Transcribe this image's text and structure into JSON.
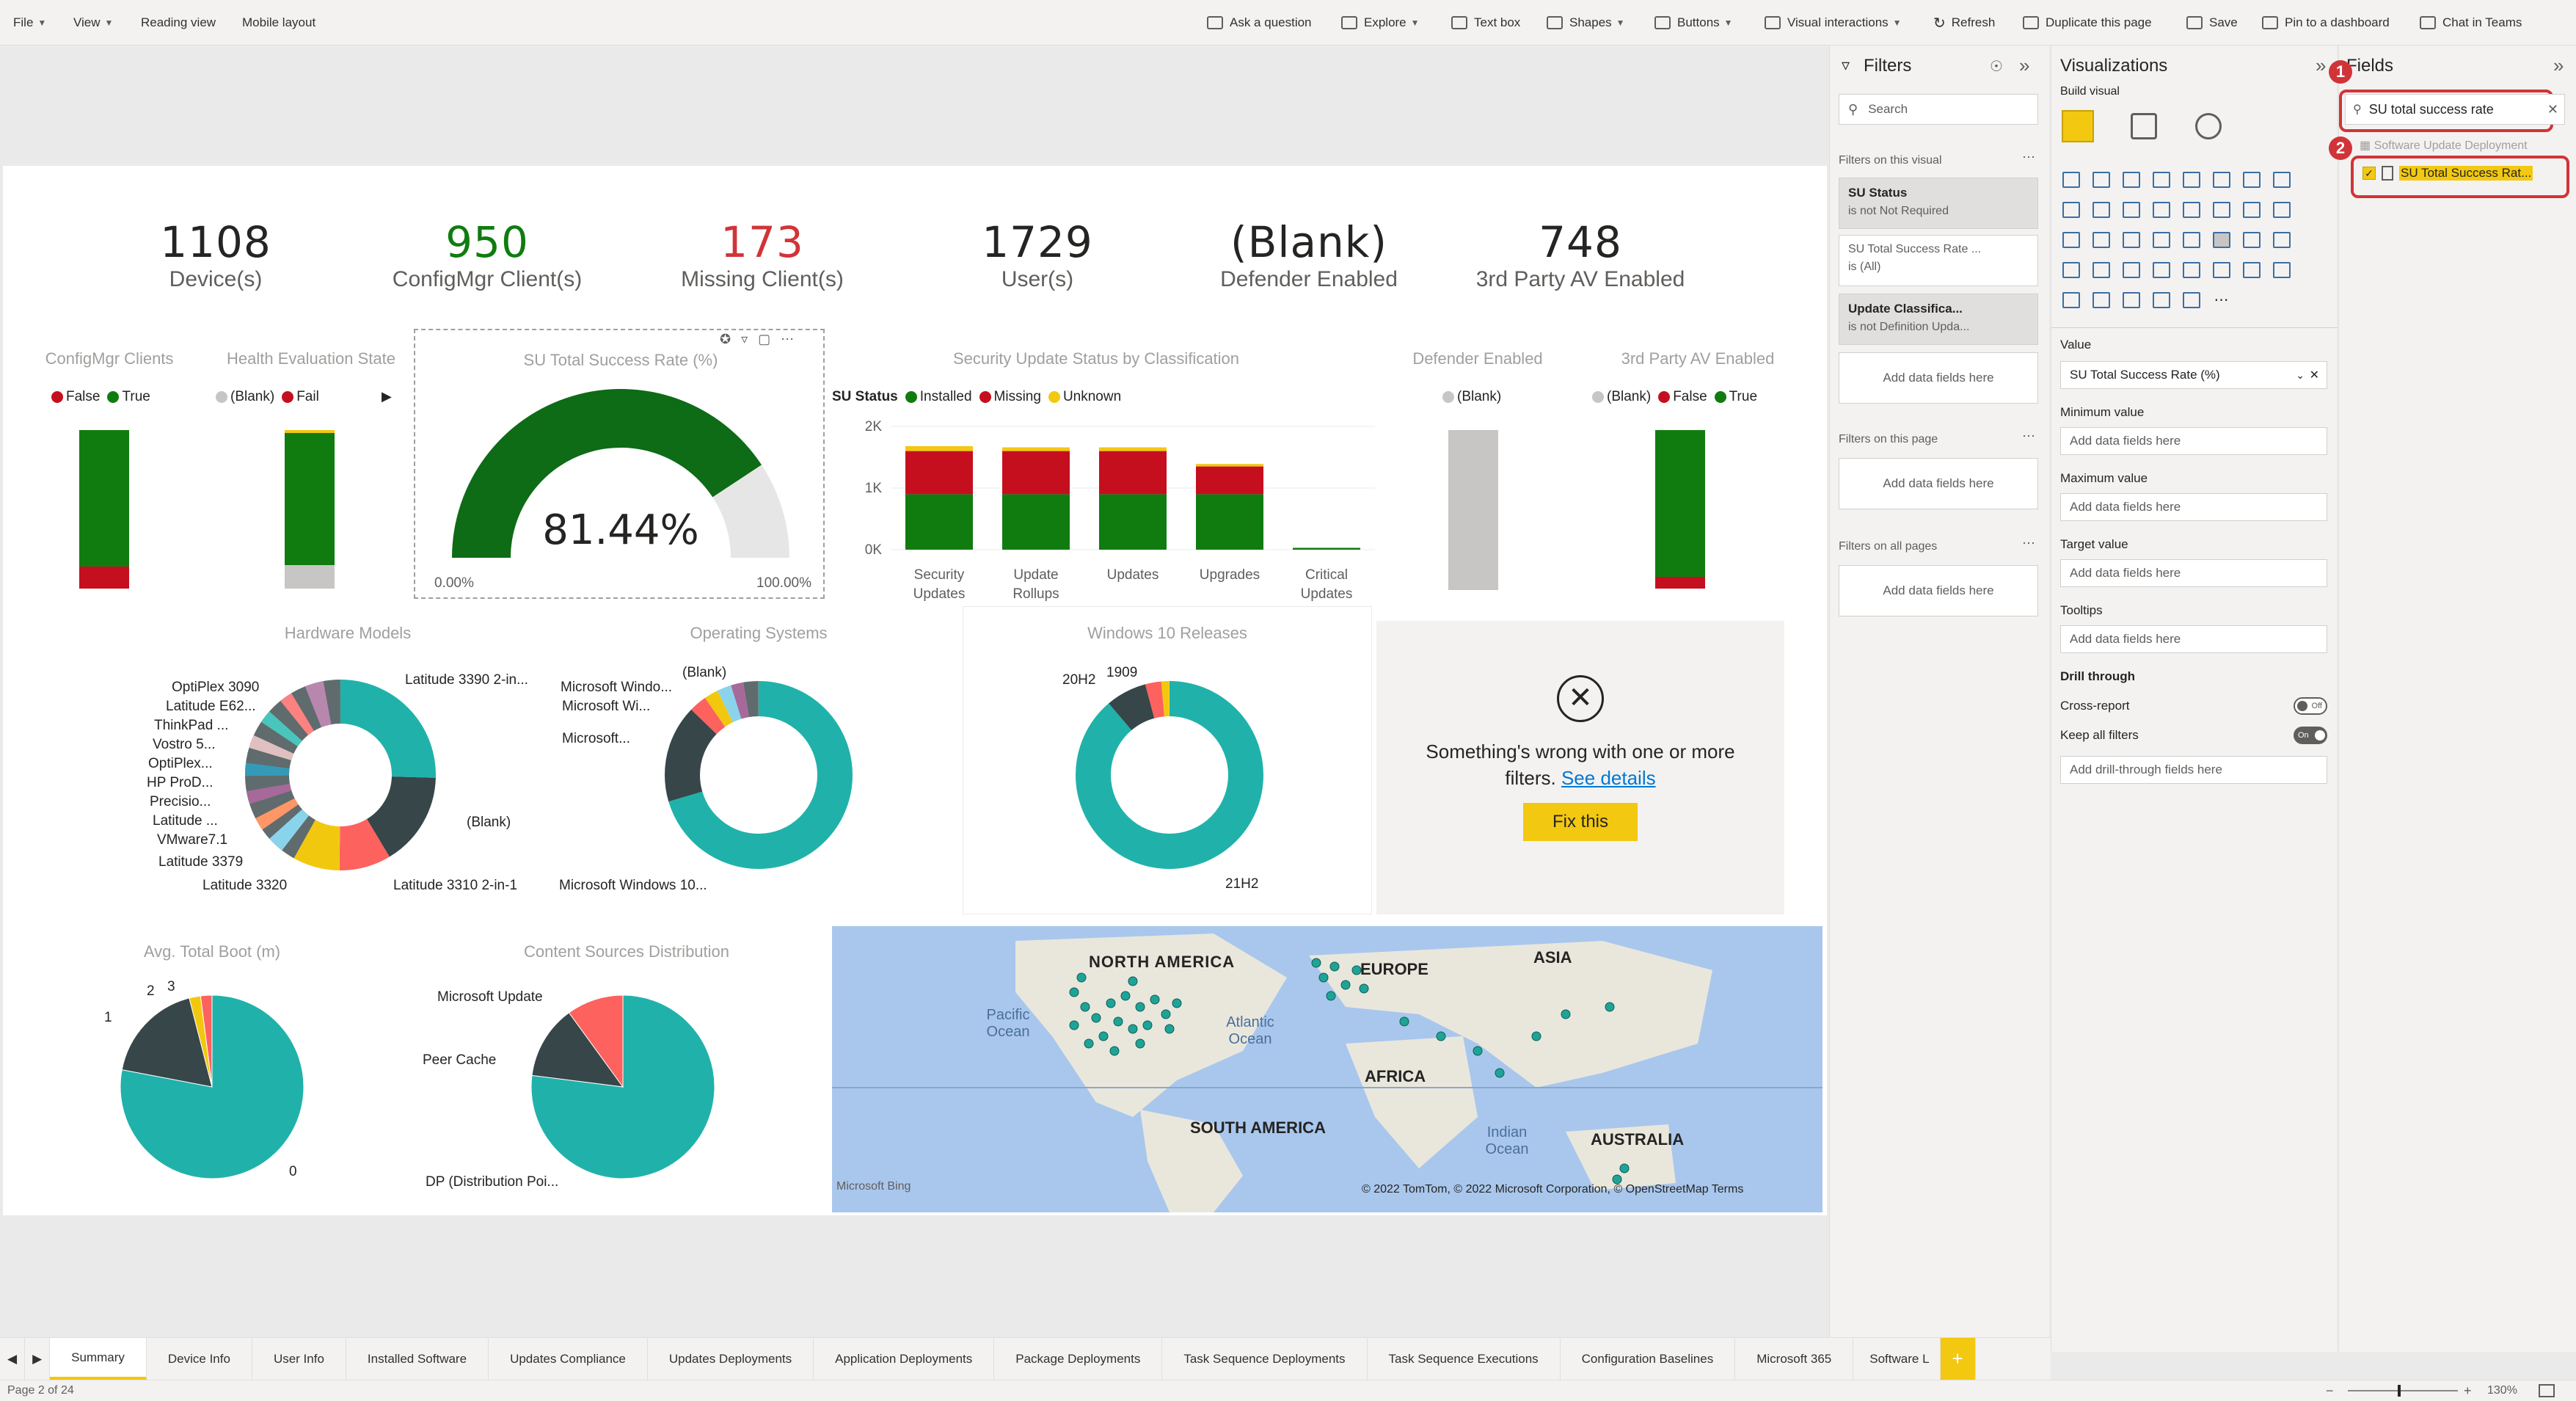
{
  "menu": {
    "file": "File",
    "view": "View",
    "reading_view": "Reading view",
    "mobile_layout": "Mobile layout",
    "ask_question": "Ask a question",
    "explore": "Explore",
    "text_box": "Text box",
    "shapes": "Shapes",
    "buttons": "Buttons",
    "visual_interactions": "Visual interactions",
    "refresh": "Refresh",
    "duplicate": "Duplicate this page",
    "save": "Save",
    "pin": "Pin to a dashboard",
    "chat": "Chat in Teams"
  },
  "kpis": [
    {
      "value": "1108",
      "label": "Device(s)",
      "color": "#252423"
    },
    {
      "value": "950",
      "label": "ConfigMgr Client(s)",
      "color": "#107c10"
    },
    {
      "value": "173",
      "label": "Missing Client(s)",
      "color": "#d13438"
    },
    {
      "value": "1729",
      "label": "User(s)",
      "color": "#252423"
    },
    {
      "value": "(Blank)",
      "label": "Defender Enabled",
      "color": "#252423"
    },
    {
      "value": "748",
      "label": "3rd Party AV Enabled",
      "color": "#252423"
    }
  ],
  "visuals": {
    "configmgr": {
      "title": "ConfigMgr Clients",
      "legend": [
        "False",
        "True"
      ]
    },
    "health": {
      "title": "Health Evaluation State",
      "legend": [
        "(Blank)",
        "Fail"
      ]
    },
    "gauge": {
      "title": "SU Total Success Rate (%)",
      "value": "81.44%",
      "min": "0.00%",
      "max": "100.00%",
      "fraction": 0.8144
    },
    "su_status": {
      "title": "Security Update Status by Classification",
      "legend_title": "SU Status",
      "legend": [
        "Installed",
        "Missing",
        "Unknown"
      ],
      "yticks": [
        "2K",
        "1K",
        "0K"
      ]
    },
    "defender": {
      "title": "Defender Enabled",
      "legend": [
        "(Blank)"
      ]
    },
    "thirdparty": {
      "title": "3rd Party AV Enabled",
      "legend": [
        "(Blank)",
        "False",
        "True"
      ]
    },
    "hw": {
      "title": "Hardware Models",
      "labels": [
        "OptiPlex 3090",
        "Latitude E62...",
        "ThinkPad ...",
        "Vostro 5...",
        "OptiPlex...",
        "HP ProD...",
        "Precisio...",
        "Latitude ...",
        "VMware7.1",
        "Latitude 3379",
        "Latitude 3320",
        "Latitude 3390 2-in...",
        "(Blank)",
        "Latitude 3310 2-in-1"
      ]
    },
    "os": {
      "title": "Operating Systems",
      "labels": [
        "Microsoft Windo...",
        "Microsoft Wi...",
        "(Blank)",
        "Microsoft...",
        "Microsoft Windows 10..."
      ]
    },
    "win10": {
      "title": "Windows 10 Releases",
      "labels": [
        "20H2",
        "1909",
        "21H2"
      ]
    },
    "error": {
      "message": "Something's wrong with one or more filters.",
      "link": "See details",
      "button": "Fix this"
    },
    "boot": {
      "title": "Avg. Total Boot (m)",
      "labels": [
        "2",
        "3",
        "1",
        "0"
      ]
    },
    "content": {
      "title": "Content Sources Distribution",
      "labels": [
        "Microsoft Update",
        "Peer Cache",
        "DP (Distribution Poi..."
      ]
    },
    "map": {
      "labels": [
        "NORTH AMERICA",
        "EUROPE",
        "ASIA",
        "AFRICA",
        "SOUTH AMERICA",
        "AUSTRALIA",
        "Pacific Ocean",
        "Atlantic Ocean",
        "Indian Ocean"
      ],
      "credit": "© 2022 TomTom, © 2022 Microsoft Corporation, © OpenStreetMap Terms",
      "bing": "Microsoft Bing"
    }
  },
  "chart_data": [
    {
      "type": "bar",
      "title": "Security Update Status by Classification",
      "categories": [
        "Security Updates",
        "Update Rollups",
        "Updates",
        "Upgrades",
        "Critical Updates"
      ],
      "ylim": [
        0,
        2000
      ],
      "series": [
        {
          "name": "Installed",
          "color": "#107c10",
          "values": [
            900,
            900,
            900,
            900,
            30
          ]
        },
        {
          "name": "Missing",
          "color": "#c50f1f",
          "values": [
            700,
            700,
            700,
            450,
            0
          ]
        },
        {
          "name": "Unknown",
          "color": "#f2c811",
          "values": [
            80,
            60,
            60,
            40,
            0
          ]
        }
      ]
    },
    {
      "type": "pie",
      "title": "Avg. Total Boot (m)",
      "categories": [
        "0",
        "1",
        "2",
        "3"
      ],
      "values": [
        78,
        18,
        2,
        2
      ]
    },
    {
      "type": "pie",
      "title": "Content Sources Distribution",
      "categories": [
        "DP (Distribution Poi...",
        "Peer Cache",
        "Microsoft Update"
      ],
      "values": [
        77,
        13,
        10
      ]
    }
  ],
  "filters": {
    "title": "Filters",
    "search": "Search",
    "on_visual": "Filters on this visual",
    "cards": [
      {
        "head": "SU Status",
        "sub": "is not Not Required"
      },
      {
        "head": "SU Total Success Rate ...",
        "sub": "is (All)"
      },
      {
        "head": "Update Classifica...",
        "sub": "is not Definition Upda..."
      }
    ],
    "add": "Add data fields here",
    "on_page": "Filters on this page",
    "on_all": "Filters on all pages"
  },
  "viz": {
    "title": "Visualizations",
    "build": "Build visual",
    "value_label": "Value",
    "value_field": "SU Total Success Rate (%)",
    "wells": [
      "Minimum value",
      "Maximum value",
      "Target value",
      "Tooltips"
    ],
    "add": "Add data fields here",
    "drill": "Drill through",
    "cross": "Cross-report",
    "keep": "Keep all filters",
    "toggle_off": "Off",
    "toggle_on": "On",
    "drill_add": "Add drill-through fields here"
  },
  "fields": {
    "title": "Fields",
    "search_value": "SU total success rate",
    "table": "Software Update Deployment",
    "field": "SU Total Success Rat...",
    "badge1": "1",
    "badge2": "2"
  },
  "tabs": [
    "Summary",
    "Device Info",
    "User Info",
    "Installed Software",
    "Updates Compliance",
    "Updates Deployments",
    "Application Deployments",
    "Package Deployments",
    "Task Sequence Deployments",
    "Task Sequence Executions",
    "Configuration Baselines",
    "Microsoft 365",
    "Software L"
  ],
  "status": {
    "page": "Page 2 of 24",
    "zoom": "130%"
  }
}
